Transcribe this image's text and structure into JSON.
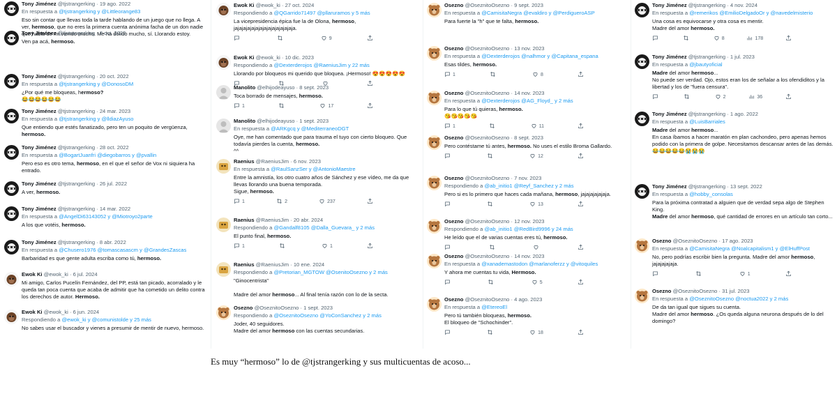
{
  "columns": [
    {
      "tweets": [
        {
          "name": "Tony Jiménez",
          "handle": "@tjstrangerking",
          "date": "19 ago. 2022",
          "reply_prefix": "En respuesta a",
          "reply_to": "@tjstrangerking y @Littleorange83",
          "text_html": "Eso sin contar que llevas toda la tarde hablando de un juego que no llega. A ver, <b>hermoso</b>, que no eres la primera cuenta anónima facha de un don nadie que habla de mí viendo mucho. Me ha dolido mucho, sí. Llorando estoy.",
          "avatar": "tony"
        },
        {
          "name": "Tony Jiménez",
          "handle": "@tjstrangerking",
          "date": "8 oct. 2022",
          "reply_prefix": "",
          "reply_to": "",
          "text_html": "Ven pa acá, <b>hermoso.</b>",
          "avatar": "tony"
        },
        {
          "name": "Tony Jiménez",
          "handle": "@tjstrangerking",
          "date": "20 oct. 2022",
          "reply_prefix": "En respuesta a",
          "reply_to": "@tjstrangerking y @DonosoDM",
          "text_html": "¿Por qué me bloqueas, h<b>ermoso?</b><br>😂😂😂😂😂😂",
          "avatar": "tony"
        },
        {
          "name": "Tony Jiménez",
          "handle": "@tjstrangerking",
          "date": "24 mar. 2023",
          "reply_prefix": "En respuesta a",
          "reply_to": "@tjstrangerking y @lldiazAyuso",
          "text_html": "Que entiendo que estés fanatizado, pero ten un poquito de vergüenza, <b>hermoso.</b>",
          "avatar": "tony"
        },
        {
          "name": "Tony Jiménez",
          "handle": "@tjstrangerking",
          "date": "28 oct. 2022",
          "reply_prefix": "En respuesta a",
          "reply_to": "@BogartJuanfri @diegobarros y @pvallin",
          "text_html": "Pero eso es otro tema, <b>hermoso</b>, en el que el señor de Vox ni siquiera ha entrado.",
          "avatar": "tony"
        },
        {
          "name": "Tony Jiménez",
          "handle": "@tjstrangerking",
          "date": "26 jul. 2022",
          "reply_prefix": "",
          "reply_to": "",
          "text_html": "A ver, <b>hermoso.</b>",
          "avatar": "tony"
        },
        {
          "name": "Tony Jiménez",
          "handle": "@tjstrangerking",
          "date": "14 mar. 2022",
          "reply_prefix": "En respuesta a",
          "reply_to": "@AngelDi63143052 y @Miotroyo2parte",
          "text_html": "A los que votéis, <b>hermoso.</b>",
          "avatar": "tony"
        },
        {
          "name": "Tony Jiménez",
          "handle": "@tjstrangerking",
          "date": "8 abr. 2022",
          "reply_prefix": "En respuesta a",
          "reply_to": "@Chusero1976 @tomascasascm y @GrandesZascas",
          "text_html": "Barbaridad es que gente adulta escriba como tú, <b>hermoso.</b>",
          "avatar": "tony"
        },
        {
          "name": "Ewok Ki",
          "handle": "@ewok_ki",
          "date": "6 jul. 2024",
          "reply_prefix": "",
          "reply_to": "",
          "text_html": "Mi amigo, Carlos Pucelín Fernández, del PP, está tan picado, acorralado y le queda tan poca cuenta que acaba de admitir que ha cometido un delito contra los derechos de autor. <b>Hermoso.</b>",
          "avatar": "ewok"
        },
        {
          "name": "Ewok Ki",
          "handle": "@ewok_ki",
          "date": "6 jun. 2024",
          "reply_prefix": "Respondiendo a",
          "reply_to": "@ewok_ki y @comunistolde y 25 más",
          "text_html": "No sabes usar el buscador y vienes a presumir de mentir de nuevo, hermoso.",
          "avatar": "ewok"
        }
      ]
    },
    {
      "tweets": [
        {
          "name": "Ewok Ki",
          "handle": "@ewok_ki",
          "date": "27 oct. 2024",
          "reply_prefix": "Respondiendo a",
          "reply_to": "@QGarrido71497 @pllaruramos y 5 más",
          "text_html": "La vicepresidencia épica fue la de Olona, <b>hermoso</b>,<br>jajajajajajajajajajajajajajaja.",
          "avatar": "ewok",
          "stats": {
            "reply": "",
            "rt": "",
            "like": "9"
          }
        },
        {
          "name": "Ewok Ki",
          "handle": "@ewok_ki",
          "date": "10 dic. 2023",
          "reply_prefix": "Respondiendo a",
          "reply_to": "@Dexterderojos @RaeniusJim y 22 más",
          "text_html": "Llorando por bloqueos mi querido que bloquea. ¡Hermoso! 😍😍😍😍😍",
          "avatar": "ewok",
          "stats": {
            "reply": "",
            "rt": "",
            "like": ""
          }
        },
        {
          "name": "Manolito",
          "handle": "@elhijodeayuso",
          "date": "8 sept. 2023",
          "reply_prefix": "",
          "reply_to": "",
          "text_html": "Toca borrado de mensajes, <b>hermoso.</b>",
          "avatar": "mano",
          "stats": {
            "reply": "1",
            "rt": "",
            "like": "17"
          }
        },
        {
          "name": "Manolito",
          "handle": "@elhijodeayuso",
          "date": "1 sept. 2023",
          "reply_prefix": "En respuesta a",
          "reply_to": "@ARKgcq y @MediterraneoDGT",
          "text_html": "Oye, me han comentado que para trauma el tuyo con cierto bloqueo. Que todavía pierdes la cuenta, <b>hermoso.</b><br>^^",
          "avatar": "mano",
          "stats": null
        },
        {
          "name": "Raenius",
          "handle": "@RaeniusJim",
          "date": "6 nov. 2023",
          "reply_prefix": "En respuesta a",
          "reply_to": "@RaulSanzSer y @AntonioMaestre",
          "text_html": "Entre la amnistía, los otro cuatro años de Sánchez y ese vídeo, me da que llevas llorando una buena temporada.<br>Sigue, <b>hermoso.</b>",
          "avatar": "rae",
          "stats": {
            "reply": "1",
            "rt": "2",
            "like": "237"
          }
        },
        {
          "name": "Raenius",
          "handle": "@RaeniusJim",
          "date": "20 abr. 2024",
          "reply_prefix": "Respondiendo a",
          "reply_to": "@Gandalf8105 @Dalla_Guevara_ y 2 más",
          "text_html": "El punto final, <b>hermoso.</b>",
          "avatar": "rae",
          "stats": {
            "reply": "1",
            "rt": "",
            "like": "1"
          }
        },
        {
          "name": "Raenius",
          "handle": "@RaeniusJim",
          "date": "10 ene. 2024",
          "reply_prefix": "Respondiendo a",
          "reply_to": "@Pretorian_MGTOW @OsenitoOsezno y 2 más",
          "text_html": "\"Ginocentrista\"<br><br>Madre del amor <b>hermoso</b>... Al final tenía razón con lo de la secta.",
          "avatar": "rae",
          "stats": null
        },
        {
          "name": "Osezno",
          "handle": "@OseznitoOsezno",
          "date": "1 sept. 2023",
          "reply_prefix": "Respondiendo a",
          "reply_to": "@OseznitoOsezno @YoConSanchez y 2 más",
          "text_html": "Joder, 40 seguidores.<br>Madre del amor <b>hermoso</b> con las cuentas secundarias.",
          "avatar": "ose",
          "stats": null
        }
      ]
    },
    {
      "tweets": [
        {
          "name": "Osezno",
          "handle": "@OseznitoOsezno",
          "date": "9 sept. 2023",
          "reply_prefix": "En respuesta a",
          "reply_to": "@CamisitaNegra @evaldiro y @PerdigueroASP",
          "text_html": "Para fuerte la \"h\" que te falta, <b>hermoso.</b>",
          "avatar": "ose",
          "stats": null
        },
        {
          "name": "Osezno",
          "handle": "@OseznitoOsezno",
          "date": "13 nov. 2023",
          "reply_prefix": "En respuesta a",
          "reply_to": "@Dexterderojos @nalhmor y @Capitana_espana",
          "text_html": "Esas tildes, <b>hermoso.</b>",
          "avatar": "ose",
          "stats": {
            "reply": "1",
            "rt": "",
            "like": "8"
          }
        },
        {
          "name": "Osezno",
          "handle": "@OseznitoOsezno",
          "date": "14 nov. 2023",
          "reply_prefix": "En respuesta a",
          "reply_to": "@Dexterderojos @AG_Floyd_ y 2 más",
          "text_html": "Para lo que tú quieras, <b>hermoso.</b><br>😘😘😘😘😘",
          "avatar": "ose",
          "stats": {
            "reply": "1",
            "rt": "",
            "like": "11"
          }
        },
        {
          "name": "Osezno",
          "handle": "@OseznitoOsezno",
          "date": "8 sept. 2023",
          "reply_prefix": "",
          "reply_to": "",
          "text_html": "Pero contéstame tú antes, <b>hermoso.</b> No uses el estilo Broma Gallardo.",
          "avatar": "ose",
          "stats": {
            "reply": "",
            "rt": "",
            "like": "12"
          }
        },
        {
          "name": "Osezno",
          "handle": "@OseznitoOsezno",
          "date": "7 nov. 2023",
          "reply_prefix": "Respondiendo a",
          "reply_to": "@ab_initio1 @Reyf_Sanchez y 2 más",
          "text_html": "Pero si es lo primero que haces cada mañana, <b>hermoso</b>, jajajajajajaja.",
          "avatar": "ose",
          "stats": {
            "reply": "",
            "rt": "",
            "like": "13"
          }
        },
        {
          "name": "Osezno",
          "handle": "@OseznitoOsezno",
          "date": "12 nov. 2023",
          "reply_prefix": "Respondiendo a",
          "reply_to": "@ab_initio1 @RedBird9996 y 24 más",
          "text_html": "He leído que el de varias cuentas eres tú, <b>hermoso.</b>",
          "avatar": "ose",
          "stats": {
            "reply": "",
            "rt": "",
            "like": ""
          }
        },
        {
          "name": "Osezno",
          "handle": "@OseznitoOsezno",
          "date": "14 nov. 2023",
          "reply_prefix": "En respuesta a",
          "reply_to": "@xanademastodon @marlanoferzz y @vitoquiles",
          "text_html": "Y ahora me cuentas tu vida, <b>Hermoso.</b>",
          "avatar": "ose",
          "stats": {
            "reply": "",
            "rt": "",
            "like": "5"
          }
        },
        {
          "name": "Osezno",
          "handle": "@OseznitoOsezno",
          "date": "4 ago. 2023",
          "reply_prefix": "En respuesta a",
          "reply_to": "@EtereoEl",
          "text_html": "Pero tú también bloqueas, <b>hermoso.</b><br>El bloqueo de \"Schochinder\".",
          "avatar": "ose",
          "stats": {
            "reply": "",
            "rt": "",
            "like": "18"
          }
        }
      ]
    },
    {
      "tweets": [
        {
          "name": "Tony Jiménez",
          "handle": "@tjstrangerking",
          "date": "4 nov. 2024",
          "reply_prefix": "En respuesta a",
          "reply_to": "@remerikos @EmilioDelgadoOr y @navedelmisterio",
          "text_html": "Una cosa es equivocarse y otra cosa es mentir.<br>Madre del amor <b>hermoso.</b>",
          "avatar": "tony",
          "stats": {
            "reply": "",
            "rt": "",
            "like": "8",
            "views": "178"
          }
        },
        {
          "name": "Tony Jiménez",
          "handle": "@tjstrangerking",
          "date": "1 jul. 2023",
          "reply_prefix": "En respuesta a",
          "reply_to": "@jbautyoficial",
          "text_html": "<b>Madre</b> del amor <b>hermoso</b>...<br>No puede ser verdad. Ojo, estos eran los de señalar a los ofendiditos y la libertad y los de \"fuera censura\".",
          "avatar": "tony",
          "stats": {
            "reply": "",
            "rt": "",
            "like": "2",
            "views": "36"
          }
        },
        {
          "name": "Tony Jiménez",
          "handle": "@tjstrangerking",
          "date": "1 ago. 2022",
          "reply_prefix": "En respuesta a",
          "reply_to": "@LuisBarriales",
          "text_html": "<b>Madre</b> del amor <b>hermoso</b>...<br>En casa íbamos a hacer maratón en plan cachondeo, pero apenas hemos podido con la primera de golpe. Necesitamos descansar antes de las demás.<br>😂😂😂😂😂😭😭😭",
          "avatar": "tony",
          "stats": null
        },
        {
          "name": "Tony Jiménez",
          "handle": "@tjstrangerking",
          "date": "13 sept. 2022",
          "reply_prefix": "En respuesta a",
          "reply_to": "@hobby_consolas",
          "text_html": "Para la próxima contratad a alguien que de verdad sepa algo de Stephen King.<br><b>Madre</b> del amor <b>hermoso</b>, qué cantidad de errores en un artículo tan corto...",
          "avatar": "tony",
          "stats": null
        },
        {
          "name": "Osezno",
          "handle": "@OseznitoOsezno",
          "date": "17 ago. 2023",
          "reply_prefix": "En respuesta a",
          "reply_to": "@CamisitaNegra @Noalcapitalism1 y @ElHuffPost",
          "text_html": "No, pero podrías escribir bien la pregunta. Madre del amor <b>hermoso</b>, jajajajajaja.",
          "avatar": "ose",
          "stats": {
            "reply": "",
            "rt": "",
            "like": "1"
          }
        },
        {
          "name": "Osezno",
          "handle": "@OseznitoOsezno",
          "date": "31 jul. 2023",
          "reply_prefix": "En respuesta a",
          "reply_to": "@OseznitoOsezno @noctua2022 y 2 más",
          "text_html": "De da tan igual que sigues su cuenta.<br>Madre del amor <b>hermoso</b>. ¿Os queda alguna neurona después de lo del domingo?",
          "avatar": "ose",
          "stats": null
        }
      ]
    }
  ],
  "caption": "Es muy “hermoso” lo de @tjstrangerking y sus multicuentas de acoso..."
}
